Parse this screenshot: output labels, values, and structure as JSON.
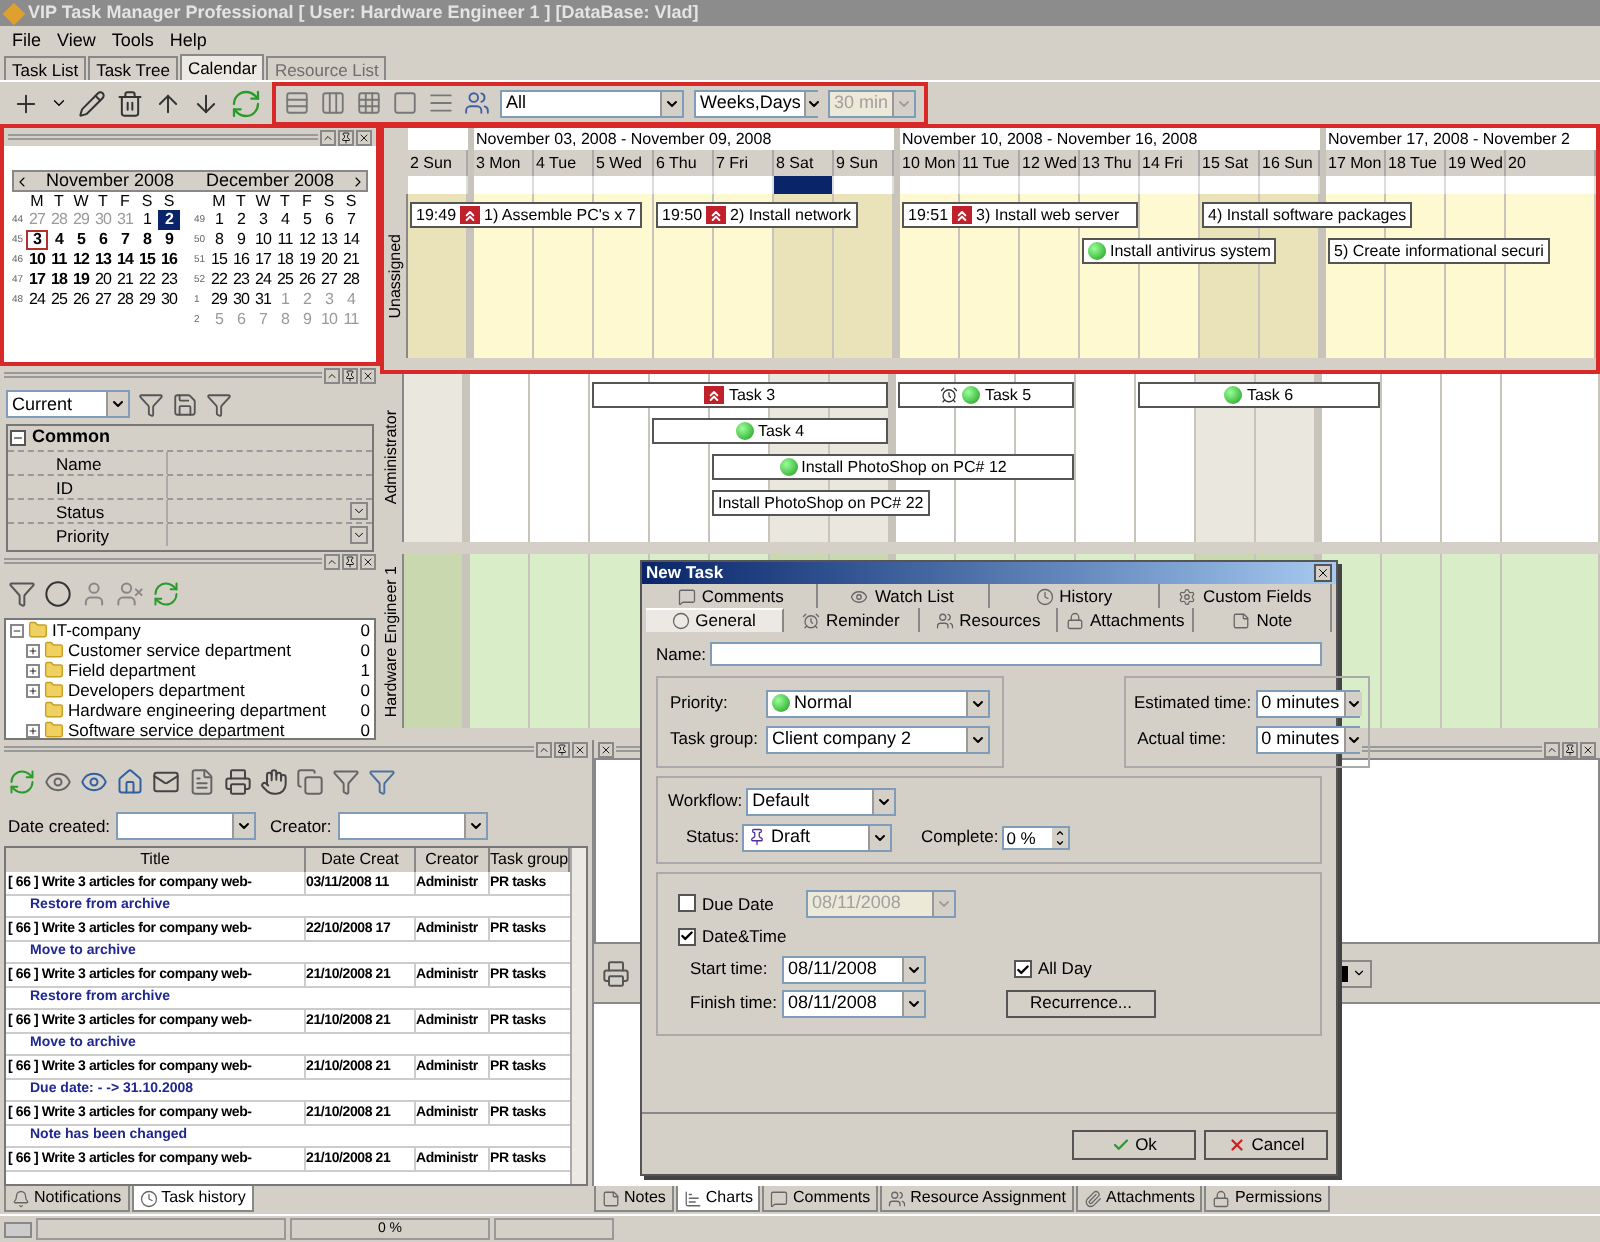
{
  "window": {
    "title": "VIP Task Manager Professional [ User: Hardware Engineer 1 ] [DataBase: Vlad]"
  },
  "menu": [
    "File",
    "View",
    "Tools",
    "Help"
  ],
  "view_tabs": [
    {
      "label": "Task List",
      "selected": false,
      "disabled": false
    },
    {
      "label": "Task Tree",
      "selected": false,
      "disabled": false
    },
    {
      "label": "Calendar",
      "selected": true,
      "disabled": false
    },
    {
      "label": "Resource List",
      "selected": false,
      "disabled": true
    }
  ],
  "toolbar": {
    "filter": {
      "value": "All"
    },
    "scale": {
      "value": "Weeks,Days"
    },
    "interval": {
      "value": "30 min",
      "disabled": true
    }
  },
  "mini_calendar": {
    "months": [
      {
        "title": "November 2008",
        "weekdays": [
          "M",
          "T",
          "W",
          "T",
          "F",
          "S",
          "S"
        ],
        "weeks": [
          {
            "number": "44",
            "days": [
              {
                "d": "27",
                "kind": "other"
              },
              {
                "d": "28",
                "kind": "other"
              },
              {
                "d": "29",
                "kind": "other"
              },
              {
                "d": "30",
                "kind": "other"
              },
              {
                "d": "31",
                "kind": "other"
              },
              {
                "d": "1",
                "kind": "plain"
              },
              {
                "d": "2",
                "kind": "selected"
              }
            ]
          },
          {
            "number": "45",
            "days": [
              {
                "d": "3",
                "kind": "today"
              },
              {
                "d": "4",
                "kind": "busy"
              },
              {
                "d": "5",
                "kind": "busy"
              },
              {
                "d": "6",
                "kind": "busy"
              },
              {
                "d": "7",
                "kind": "busy"
              },
              {
                "d": "8",
                "kind": "busy"
              },
              {
                "d": "9",
                "kind": "busy"
              }
            ]
          },
          {
            "number": "46",
            "days": [
              {
                "d": "10",
                "kind": "busy"
              },
              {
                "d": "11",
                "kind": "busy"
              },
              {
                "d": "12",
                "kind": "busy"
              },
              {
                "d": "13",
                "kind": "busy"
              },
              {
                "d": "14",
                "kind": "busy"
              },
              {
                "d": "15",
                "kind": "busy"
              },
              {
                "d": "16",
                "kind": "busy"
              }
            ]
          },
          {
            "number": "47",
            "days": [
              {
                "d": "17",
                "kind": "busy"
              },
              {
                "d": "18",
                "kind": "busy"
              },
              {
                "d": "19",
                "kind": "busy"
              },
              {
                "d": "20",
                "kind": "plain"
              },
              {
                "d": "21",
                "kind": "plain"
              },
              {
                "d": "22",
                "kind": "plain"
              },
              {
                "d": "23",
                "kind": "plain"
              }
            ]
          },
          {
            "number": "48",
            "days": [
              {
                "d": "24",
                "kind": "plain"
              },
              {
                "d": "25",
                "kind": "plain"
              },
              {
                "d": "26",
                "kind": "plain"
              },
              {
                "d": "27",
                "kind": "plain"
              },
              {
                "d": "28",
                "kind": "plain"
              },
              {
                "d": "29",
                "kind": "plain"
              },
              {
                "d": "30",
                "kind": "plain"
              }
            ]
          }
        ]
      },
      {
        "title": "December 2008",
        "weekdays": [
          "M",
          "T",
          "W",
          "T",
          "F",
          "S",
          "S"
        ],
        "weeks": [
          {
            "number": "49",
            "days": [
              {
                "d": "1",
                "kind": "plain"
              },
              {
                "d": "2",
                "kind": "plain"
              },
              {
                "d": "3",
                "kind": "plain"
              },
              {
                "d": "4",
                "kind": "plain"
              },
              {
                "d": "5",
                "kind": "plain"
              },
              {
                "d": "6",
                "kind": "plain"
              },
              {
                "d": "7",
                "kind": "plain"
              }
            ]
          },
          {
            "number": "50",
            "days": [
              {
                "d": "8",
                "kind": "plain"
              },
              {
                "d": "9",
                "kind": "plain"
              },
              {
                "d": "10",
                "kind": "plain"
              },
              {
                "d": "11",
                "kind": "plain"
              },
              {
                "d": "12",
                "kind": "plain"
              },
              {
                "d": "13",
                "kind": "plain"
              },
              {
                "d": "14",
                "kind": "plain"
              }
            ]
          },
          {
            "number": "51",
            "days": [
              {
                "d": "15",
                "kind": "plain"
              },
              {
                "d": "16",
                "kind": "plain"
              },
              {
                "d": "17",
                "kind": "plain"
              },
              {
                "d": "18",
                "kind": "plain"
              },
              {
                "d": "19",
                "kind": "plain"
              },
              {
                "d": "20",
                "kind": "plain"
              },
              {
                "d": "21",
                "kind": "plain"
              }
            ]
          },
          {
            "number": "52",
            "days": [
              {
                "d": "22",
                "kind": "plain"
              },
              {
                "d": "23",
                "kind": "plain"
              },
              {
                "d": "24",
                "kind": "plain"
              },
              {
                "d": "25",
                "kind": "plain"
              },
              {
                "d": "26",
                "kind": "plain"
              },
              {
                "d": "27",
                "kind": "plain"
              },
              {
                "d": "28",
                "kind": "plain"
              }
            ]
          },
          {
            "number": "1",
            "days": [
              {
                "d": "29",
                "kind": "plain"
              },
              {
                "d": "30",
                "kind": "plain"
              },
              {
                "d": "31",
                "kind": "plain"
              },
              {
                "d": "1",
                "kind": "other"
              },
              {
                "d": "2",
                "kind": "other"
              },
              {
                "d": "3",
                "kind": "other"
              },
              {
                "d": "4",
                "kind": "other"
              }
            ]
          },
          {
            "number": "2",
            "days": [
              {
                "d": "5",
                "kind": "other"
              },
              {
                "d": "6",
                "kind": "other"
              },
              {
                "d": "7",
                "kind": "other"
              },
              {
                "d": "8",
                "kind": "other"
              },
              {
                "d": "9",
                "kind": "other"
              },
              {
                "d": "10",
                "kind": "other"
              },
              {
                "d": "11",
                "kind": "other"
              }
            ]
          }
        ]
      }
    ]
  },
  "properties": {
    "view": {
      "value": "Current"
    },
    "category": {
      "label": "Common",
      "expanded": true
    },
    "rows": [
      {
        "name": "Name",
        "dropdown": false
      },
      {
        "name": "ID",
        "dropdown": false
      },
      {
        "name": "Status",
        "dropdown": true
      },
      {
        "name": "Priority",
        "dropdown": true
      }
    ]
  },
  "departments": {
    "label": "IT-company",
    "count": "0",
    "expanded": true,
    "children": [
      {
        "label": "Customer service department",
        "count": "0",
        "kind": "group"
      },
      {
        "label": "Field department",
        "count": "1",
        "kind": "group"
      },
      {
        "label": "Developers department",
        "count": "0",
        "kind": "group"
      },
      {
        "label": "Hardware engineering department",
        "count": "0",
        "kind": "leaf"
      },
      {
        "label": "Software service department",
        "count": "0",
        "kind": "group"
      }
    ]
  },
  "scheduler": {
    "weeks": [
      {
        "days": [
          {
            "label": "2 Sun",
            "weekend": true,
            "selected": false
          }
        ]
      },
      {
        "title": "November 03, 2008 - November 09, 2008",
        "days": [
          {
            "label": "3 Mon",
            "weekend": false,
            "selected": false
          },
          {
            "label": "4 Tue",
            "weekend": false,
            "selected": false
          },
          {
            "label": "5 Wed",
            "weekend": false,
            "selected": false
          },
          {
            "label": "6 Thu",
            "weekend": false,
            "selected": false
          },
          {
            "label": "7 Fri",
            "weekend": false,
            "selected": false
          },
          {
            "label": "8 Sat",
            "weekend": true,
            "selected": true
          },
          {
            "label": "9 Sun",
            "weekend": true,
            "selected": false
          }
        ]
      },
      {
        "title": "November 10, 2008 - November 16, 2008",
        "days": [
          {
            "label": "10 Mon",
            "weekend": false,
            "selected": false
          },
          {
            "label": "11 Tue",
            "weekend": false,
            "selected": false
          },
          {
            "label": "12 Wed",
            "weekend": false,
            "selected": false
          },
          {
            "label": "13 Thu",
            "weekend": false,
            "selected": false
          },
          {
            "label": "14 Fri",
            "weekend": false,
            "selected": false
          },
          {
            "label": "15 Sat",
            "weekend": true,
            "selected": false
          },
          {
            "label": "16 Sun",
            "weekend": true,
            "selected": false
          }
        ]
      },
      {
        "title": "November 17, 2008 - November 2",
        "days": [
          {
            "label": "17 Mon",
            "weekend": false,
            "selected": false
          },
          {
            "label": "18 Tue",
            "weekend": false,
            "selected": false
          },
          {
            "label": "19 Wed",
            "weekend": false,
            "selected": false
          },
          {
            "label": "20",
            "weekend": false,
            "selected": false
          }
        ]
      }
    ],
    "resources": [
      {
        "name": "Unassigned",
        "color": "#fff9d2",
        "lanes": [
          [
            {
              "time": "19:49",
              "label": "1) Assemble PC's x 7",
              "kind": "high",
              "reminder": false
            },
            {
              "time": "19:50",
              "label": "2) Install network",
              "kind": "high",
              "reminder": false
            },
            {
              "time": "19:51",
              "label": "3) Install web server",
              "kind": "high",
              "reminder": false
            },
            {
              "label": "4) Install software packages",
              "kind": "none",
              "reminder": false
            }
          ],
          [
            {
              "label": "Install antivirus system",
              "kind": "normal",
              "reminder": false
            },
            {
              "label": "5) Create informational securi",
              "kind": "none",
              "reminder": false
            }
          ]
        ]
      },
      {
        "name": "Administrator",
        "color": "#ffffff",
        "lanes": [
          [
            {
              "label": "Task 3",
              "kind": "high",
              "reminder": false
            },
            {
              "label": "Task 5",
              "kind": "normal",
              "reminder": true
            },
            {
              "label": "Task 6",
              "kind": "normal",
              "reminder": false
            }
          ],
          [
            {
              "label": "Task 4",
              "kind": "normal",
              "reminder": false
            }
          ],
          [
            {
              "label": "Install PhotoShop on PC# 12",
              "kind": "normal",
              "reminder": false
            }
          ],
          [
            {
              "label": "Install PhotoShop on PC# 22",
              "kind": "none",
              "reminder": false
            }
          ]
        ]
      },
      {
        "name": "Hardware Engineer 1",
        "color": "#d9edc9"
      }
    ]
  },
  "history": {
    "date_created": {
      "label": "Date created:"
    },
    "creator": {
      "label": "Creator:"
    },
    "columns": [
      "Title",
      "Date Creat",
      "Creator",
      "Task group"
    ],
    "rows": [
      {
        "title": "[ 66 ] Write 3 articles for company web-",
        "date": "03/11/2008 11",
        "creator": "Administr",
        "group": "PR tasks",
        "action": "Restore from archive"
      },
      {
        "title": "[ 66 ] Write 3 articles for company web-",
        "date": "22/10/2008 17",
        "creator": "Administr",
        "group": "PR tasks",
        "action": "Move to archive"
      },
      {
        "title": "[ 66 ] Write 3 articles for company web-",
        "date": "21/10/2008 21",
        "creator": "Administr",
        "group": "PR tasks",
        "action": "Restore from archive"
      },
      {
        "title": "[ 66 ] Write 3 articles for company web-",
        "date": "21/10/2008 21",
        "creator": "Administr",
        "group": "PR tasks",
        "action": "Move to archive"
      },
      {
        "title": "[ 66 ] Write 3 articles for company web-",
        "date": "21/10/2008 21",
        "creator": "Administr",
        "group": "PR tasks",
        "action": "Due date: - -> 31.10.2008"
      },
      {
        "title": "[ 66 ] Write 3 articles for company web-",
        "date": "21/10/2008 21",
        "creator": "Administr",
        "group": "PR tasks",
        "action": "Note has been changed"
      },
      {
        "title": "[ 66 ] Write 3 articles for company web-",
        "date": "21/10/2008 21",
        "creator": "Administr",
        "group": "PR tasks"
      }
    ]
  },
  "left_tabs": [
    {
      "label": "Notifications",
      "selected": false
    },
    {
      "label": "Task history",
      "selected": true
    }
  ],
  "detail_tabs": [
    {
      "label": "Notes",
      "selected": false
    },
    {
      "label": "Charts",
      "selected": true
    },
    {
      "label": "Comments",
      "selected": false
    },
    {
      "label": "Resource Assignment",
      "selected": false
    },
    {
      "label": "Attachments",
      "selected": false
    },
    {
      "label": "Permissions",
      "selected": false
    }
  ],
  "status_bar": {
    "progress": {
      "label": "0 %",
      "level": 0
    }
  },
  "dialog": {
    "title": "New Task",
    "tabs_row1": [
      {
        "label": "Comments",
        "selected": false
      },
      {
        "label": "Watch List",
        "selected": false
      },
      {
        "label": "History",
        "selected": false
      },
      {
        "label": "Custom Fields",
        "selected": false
      }
    ],
    "tabs_row2": [
      {
        "label": "General",
        "selected": true
      },
      {
        "label": "Reminder",
        "selected": false
      },
      {
        "label": "Resources",
        "selected": false
      },
      {
        "label": "Attachments",
        "selected": false
      },
      {
        "label": "Note",
        "selected": false
      }
    ],
    "name": {
      "label": "Name:"
    },
    "priority": {
      "label": "Priority:",
      "value": "Normal"
    },
    "task_group": {
      "label": "Task group:",
      "value": "Client company 2"
    },
    "estimated_time": {
      "label": "Estimated time:",
      "value": "0 minutes"
    },
    "actual_time": {
      "label": "Actual time:",
      "value": "0 minutes"
    },
    "workflow": {
      "label": "Workflow:",
      "value": "Default"
    },
    "status": {
      "label": "Status:",
      "value": "Draft"
    },
    "complete": {
      "label": "Complete:",
      "value": "0 %"
    },
    "due_date": {
      "label": "Due Date",
      "checked": false,
      "value": "08/11/2008"
    },
    "date_time": {
      "label": "Date&Time",
      "checked": true
    },
    "start_time": {
      "label": "Start time:",
      "value": "08/11/2008"
    },
    "finish_time": {
      "label": "Finish time:",
      "value": "08/11/2008"
    },
    "all_day": {
      "label": "All Day",
      "checked": true
    },
    "recurrence": "Recurrence...",
    "ok": "Ok",
    "cancel": "Cancel"
  }
}
